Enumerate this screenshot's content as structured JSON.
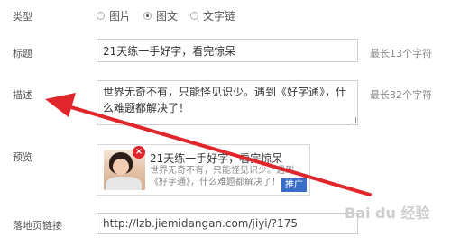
{
  "form": {
    "type_label": "类型",
    "type_options": [
      {
        "label": "图片",
        "checked": false
      },
      {
        "label": "图文",
        "checked": true
      },
      {
        "label": "文字链",
        "checked": false
      }
    ],
    "title_label": "标题",
    "title_value": "21天练一手好字，看完惊呆",
    "title_hint": "最长13个字符",
    "desc_label": "描述",
    "desc_value": "世界无奇不有，只能怪见识少。遇到《好字通》，什么难题都解决了！",
    "desc_hint": "最长32个字符",
    "preview_label": "预览",
    "preview": {
      "title": "21天练一手好字，看完惊呆",
      "desc": "世界无奇不有，只能怪见识少。遇到《好字通》，什么难题都解决了！",
      "promo": "推广",
      "close_symbol": "×"
    },
    "link_label": "落地页链接",
    "link_value": "http://lzb.jiemidangan.com/jiyi/?175"
  },
  "watermark": "Bai du 经验",
  "colors": {
    "arrow": "#e0252b",
    "promo": "#3a6dc8"
  }
}
